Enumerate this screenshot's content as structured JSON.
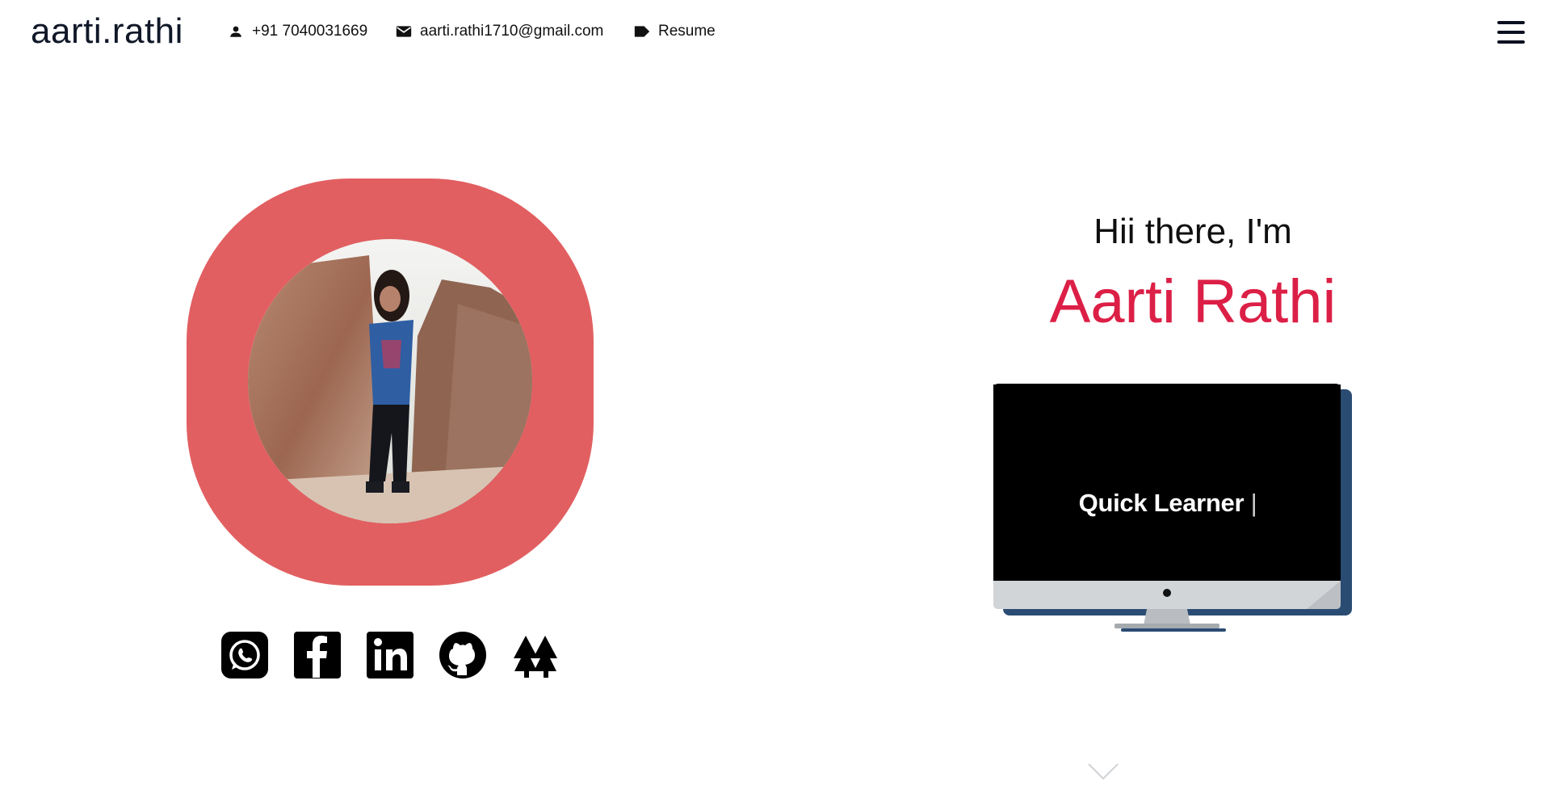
{
  "header": {
    "brand": "aarti.rathi",
    "phone": "+91 7040031669",
    "email": "aarti.rathi1710@gmail.com",
    "resume_label": "Resume",
    "menu_icon": "hamburger-icon"
  },
  "hero": {
    "greeting": "Hii there, I'm",
    "name": "Aarti Rathi",
    "typing_text": "Quick Learner",
    "caret": "|"
  },
  "socials": [
    {
      "name": "WhatsApp",
      "icon": "whatsapp-icon"
    },
    {
      "name": "Facebook",
      "icon": "facebook-icon"
    },
    {
      "name": "LinkedIn",
      "icon": "linkedin-icon"
    },
    {
      "name": "GitHub",
      "icon": "github-icon"
    },
    {
      "name": "Codechef",
      "icon": "arrows-up-icon"
    }
  ],
  "colors": {
    "accent": "#dc1f46",
    "frame": "#e25f61",
    "monitor_shadow": "#2b4c72"
  }
}
